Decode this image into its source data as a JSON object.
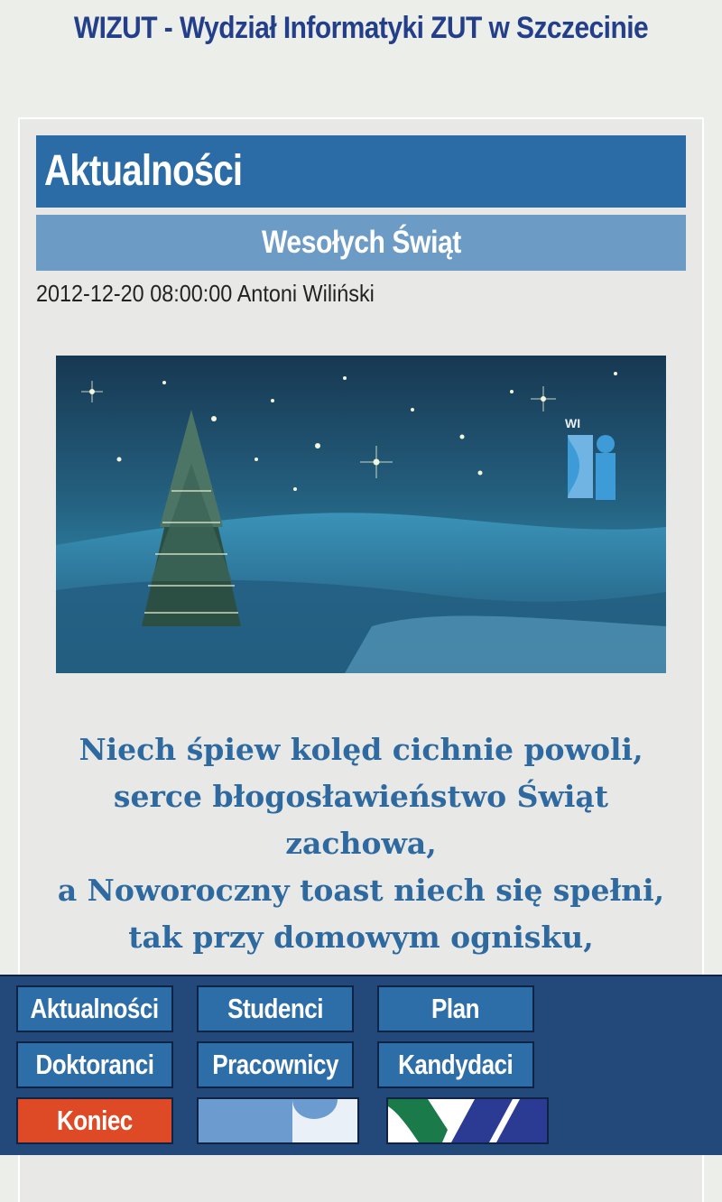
{
  "header": {
    "title": "WIZUT - Wydział Informatyki ZUT w Szczecinie"
  },
  "section": {
    "title": "Aktualności"
  },
  "article": {
    "title": "Wesołych Świąt",
    "date": "2012-12-20 08:00:00",
    "author": "Antoni Wiliński",
    "image_logo_text": "WI",
    "poem": [
      "Niech śpiew kolęd cichnie powoli,",
      "serce błogosławieństwo Świąt",
      "zachowa,",
      "a Noworoczny toast niech się spełni,",
      "tak przy domowym ognisku,"
    ]
  },
  "nav": {
    "buttons": [
      {
        "label": "Aktualności"
      },
      {
        "label": "Studenci"
      },
      {
        "label": "Plan"
      },
      {
        "label": "Doktoranci"
      },
      {
        "label": "Pracownicy"
      },
      {
        "label": "Kandydaci"
      },
      {
        "label": "Koniec"
      }
    ],
    "logo_buttons": [
      {
        "icon": "wi-logo-icon"
      },
      {
        "icon": "zut-logo-icon"
      }
    ]
  },
  "colors": {
    "title_text": "#243f8a",
    "section_header": "#2c6ca6",
    "article_title_bar": "#6c9cc6",
    "poem_text": "#2e6aa0",
    "nav_background": "#23497a",
    "nav_button": "#2d6da8",
    "exit_button": "#df4a26"
  }
}
